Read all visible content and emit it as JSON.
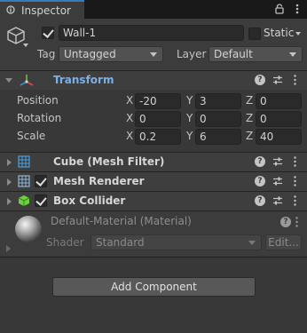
{
  "tab": {
    "label": "Inspector"
  },
  "object": {
    "name": "Wall-1",
    "active": true,
    "static_label": "Static",
    "static_checked": false
  },
  "tag": {
    "label": "Tag",
    "value": "Untagged"
  },
  "layer": {
    "label": "Layer",
    "value": "Default"
  },
  "transform": {
    "title": "Transform",
    "rows": [
      {
        "label": "Position",
        "x": "-20",
        "y": "3",
        "z": "0"
      },
      {
        "label": "Rotation",
        "x": "0",
        "y": "0",
        "z": "0"
      },
      {
        "label": "Scale",
        "x": "0.2",
        "y": "6",
        "z": "40"
      }
    ],
    "axes": {
      "x": "X",
      "y": "Y",
      "z": "Z"
    }
  },
  "components": [
    {
      "title": "Cube (Mesh Filter)",
      "has_checkbox": false,
      "icon": "mesh-filter-icon"
    },
    {
      "title": "Mesh Renderer",
      "has_checkbox": true,
      "icon": "mesh-renderer-icon"
    },
    {
      "title": "Box Collider",
      "has_checkbox": true,
      "icon": "box-collider-icon"
    }
  ],
  "material": {
    "title": "Default-Material (Material)",
    "shader_label": "Shader",
    "shader_value": "Standard",
    "edit_label": "Edit..."
  },
  "add_component": {
    "label": "Add Component"
  },
  "colors": {
    "accent": "#3a79bb",
    "transform_title": "#7ab0e8",
    "background": "#383838"
  }
}
